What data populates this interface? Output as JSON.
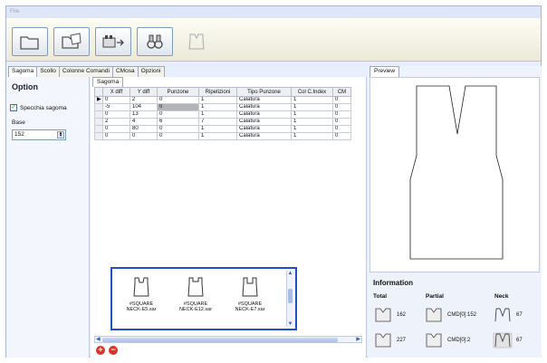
{
  "menu": {
    "file_label": "File"
  },
  "toolbar": {
    "buttons": [
      {
        "name": "open-folder-button",
        "icon": "folder-icon"
      },
      {
        "name": "open-file-button",
        "icon": "folder-open-icon"
      },
      {
        "name": "machine-export-button",
        "icon": "machine-arrow-icon"
      },
      {
        "name": "search-file-button",
        "icon": "binoculars-icon"
      },
      {
        "name": "garment-button",
        "icon": "garment-outline-icon"
      }
    ]
  },
  "main_tabs": [
    "Sagoma",
    "Scollo",
    "Colonne Comandi",
    "CMosa",
    "Opzioni"
  ],
  "option_panel": {
    "title": "Option",
    "mirror_label": "Specchia sagoma",
    "mirror_checked": true,
    "base_label": "Base",
    "base_value": "152"
  },
  "sub_tab": "Sagoma",
  "grid": {
    "columns": [
      "X diff",
      "Y diff",
      "Punzone",
      "Ripetizioni",
      "Tipo Punzone",
      "Col C.Index",
      "CM"
    ],
    "rows": [
      [
        "0",
        "2",
        "0",
        "1",
        "Calatura",
        "1",
        "0"
      ],
      [
        "-5",
        "104",
        "0",
        "1",
        "Calatura",
        "1",
        "0"
      ],
      [
        "0",
        "13",
        "0",
        "1",
        "Calatura",
        "1",
        "0"
      ],
      [
        "2",
        "4",
        "6",
        "7",
        "Calatura",
        "1",
        "0"
      ],
      [
        "0",
        "80",
        "0",
        "1",
        "Calatura",
        "1",
        "0"
      ],
      [
        "0",
        "0",
        "0",
        "1",
        "Calatura",
        "1",
        "0"
      ]
    ]
  },
  "thumbnails": [
    {
      "line1": "#SQUARE",
      "line2": "NECK-E5.sar"
    },
    {
      "line1": "#SQUARE",
      "line2": "NECK-E12.sar"
    },
    {
      "line1": "#SQUARE",
      "line2": "NECK-E7.sar"
    }
  ],
  "preview_tab": "Preview",
  "information": {
    "title": "Information",
    "total_label": "Total",
    "partial_label": "Partial",
    "neck_label": "Neck",
    "total_1": "162",
    "total_2": "227",
    "partial_1": "CMD[0]:152",
    "partial_2": "CMD[0]:2",
    "neck_1": "67",
    "neck_2": "67"
  },
  "colors": {
    "accent": "#1f4fc4",
    "window_bg": "#e9eefc",
    "delete_red": "#d9342b"
  }
}
